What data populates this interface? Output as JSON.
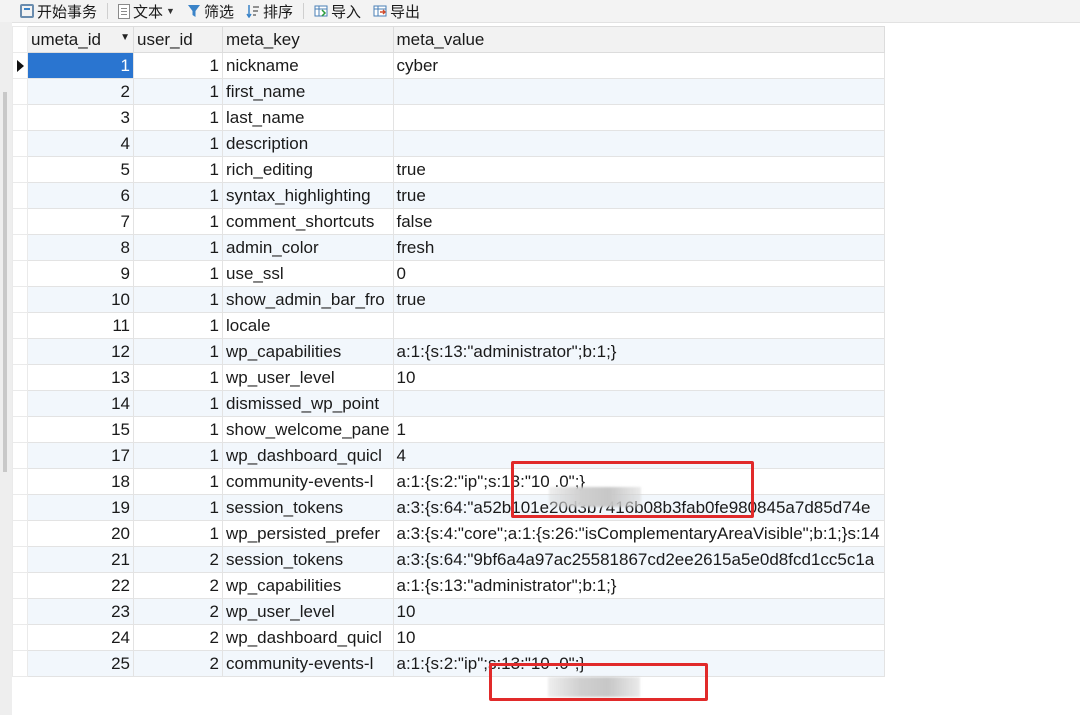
{
  "toolbar": {
    "begin_transaction": "开始事务",
    "text": "文本",
    "filter": "筛选",
    "sort": "排序",
    "import": "导入",
    "export": "导出"
  },
  "columns": [
    "umeta_id",
    "user_id",
    "meta_key",
    "meta_value"
  ],
  "rows": [
    {
      "umeta_id": "1",
      "user_id": "1",
      "meta_key": "nickname",
      "meta_value": "cyber"
    },
    {
      "umeta_id": "2",
      "user_id": "1",
      "meta_key": "first_name",
      "meta_value": ""
    },
    {
      "umeta_id": "3",
      "user_id": "1",
      "meta_key": "last_name",
      "meta_value": ""
    },
    {
      "umeta_id": "4",
      "user_id": "1",
      "meta_key": "description",
      "meta_value": ""
    },
    {
      "umeta_id": "5",
      "user_id": "1",
      "meta_key": "rich_editing",
      "meta_value": "true"
    },
    {
      "umeta_id": "6",
      "user_id": "1",
      "meta_key": "syntax_highlighting",
      "meta_value": "true"
    },
    {
      "umeta_id": "7",
      "user_id": "1",
      "meta_key": "comment_shortcuts",
      "meta_value": "false"
    },
    {
      "umeta_id": "8",
      "user_id": "1",
      "meta_key": "admin_color",
      "meta_value": "fresh"
    },
    {
      "umeta_id": "9",
      "user_id": "1",
      "meta_key": "use_ssl",
      "meta_value": "0"
    },
    {
      "umeta_id": "10",
      "user_id": "1",
      "meta_key": "show_admin_bar_fro",
      "meta_value": "true"
    },
    {
      "umeta_id": "11",
      "user_id": "1",
      "meta_key": "locale",
      "meta_value": ""
    },
    {
      "umeta_id": "12",
      "user_id": "1",
      "meta_key": "wp_capabilities",
      "meta_value": "a:1:{s:13:\"administrator\";b:1;}"
    },
    {
      "umeta_id": "13",
      "user_id": "1",
      "meta_key": "wp_user_level",
      "meta_value": "10"
    },
    {
      "umeta_id": "14",
      "user_id": "1",
      "meta_key": "dismissed_wp_point",
      "meta_value": ""
    },
    {
      "umeta_id": "15",
      "user_id": "1",
      "meta_key": "show_welcome_pane",
      "meta_value": "1"
    },
    {
      "umeta_id": "17",
      "user_id": "1",
      "meta_key": "wp_dashboard_quicl",
      "meta_value": "4"
    },
    {
      "umeta_id": "18",
      "user_id": "1",
      "meta_key": "community-events-l",
      "meta_value": "a:1:{s:2:\"ip\";s:13:\"10            .0\";}"
    },
    {
      "umeta_id": "19",
      "user_id": "1",
      "meta_key": "session_tokens",
      "meta_value": "a:3:{s:64:\"a52b101e20d3b7416b08b3fab0fe980845a7d85d74e"
    },
    {
      "umeta_id": "20",
      "user_id": "1",
      "meta_key": "wp_persisted_prefer",
      "meta_value": "a:3:{s:4:\"core\";a:1:{s:26:\"isComplementaryAreaVisible\";b:1;}s:14"
    },
    {
      "umeta_id": "21",
      "user_id": "2",
      "meta_key": "session_tokens",
      "meta_value": "a:3:{s:64:\"9bf6a4a97ac25581867cd2ee2615a5e0d8fcd1cc5c1a"
    },
    {
      "umeta_id": "22",
      "user_id": "2",
      "meta_key": "wp_capabilities",
      "meta_value": "a:1:{s:13:\"administrator\";b:1;}"
    },
    {
      "umeta_id": "23",
      "user_id": "2",
      "meta_key": "wp_user_level",
      "meta_value": "10"
    },
    {
      "umeta_id": "24",
      "user_id": "2",
      "meta_key": "wp_dashboard_quicl",
      "meta_value": "10"
    },
    {
      "umeta_id": "25",
      "user_id": "2",
      "meta_key": "community-events-l",
      "meta_value": "a:1:{s:2:\"ip\";s:13:\"10            .0\";}"
    }
  ],
  "selected_row_index": 0,
  "accent_color": "#2a75d0",
  "highlight_color": "#e12a2a"
}
